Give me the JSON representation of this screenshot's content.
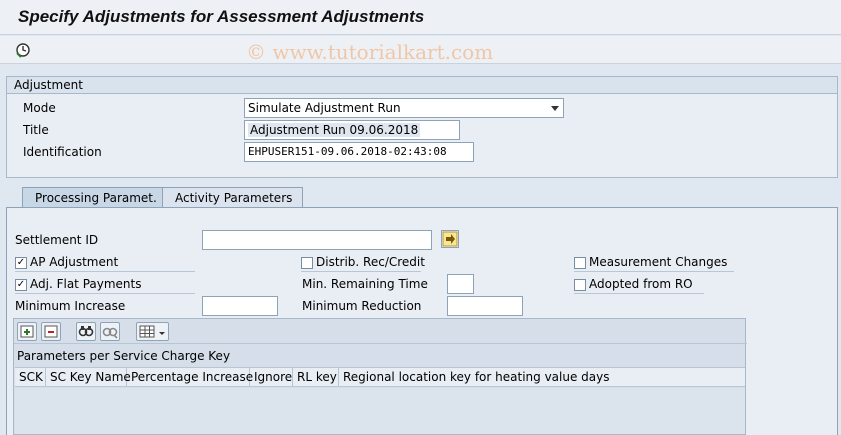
{
  "title": "Specify Adjustments for Assessment Adjustments",
  "watermark": "© www.tutorialkart.com",
  "toolbar": {
    "execute_icon": "execute-clock-icon"
  },
  "adjustment_group": {
    "header": "Adjustment",
    "mode_label": "Mode",
    "mode_value": "Simulate Adjustment Run",
    "title_label": "Title",
    "title_value": "Adjustment Run 09.06.2018",
    "identification_label": "Identification",
    "identification_value": "EHPUSER151-09.06.2018-02:43:08"
  },
  "tabs": [
    {
      "label": "Processing Paramet.",
      "active": true
    },
    {
      "label": "Activity Parameters",
      "active": false
    }
  ],
  "processing": {
    "settlement_id_label": "Settlement ID",
    "settlement_id_value": "",
    "ap_adjustment_label": "AP Adjustment",
    "ap_adjustment_checked": true,
    "distrib_label": "Distrib. Rec/Credit",
    "distrib_checked": false,
    "measurement_label": "Measurement Changes",
    "measurement_checked": false,
    "adj_flat_label": "Adj. Flat Payments",
    "adj_flat_checked": true,
    "min_remaining_label": "Min. Remaining Time",
    "min_remaining_value": "",
    "adopted_label": "Adopted from RO",
    "adopted_checked": false,
    "min_increase_label": "Minimum Increase",
    "min_increase_value": "",
    "min_reduction_label": "Minimum Reduction",
    "min_reduction_value": ""
  },
  "table": {
    "title": "Parameters per Service Charge Key",
    "columns": [
      "SCK",
      "SC Key Name",
      "Percentage Increase",
      "Ignore",
      "RL key",
      "Regional location key for heating value days"
    ]
  },
  "colors": {
    "background": "#dfe8f1",
    "panel": "#e9eef4",
    "border": "#8fa3b8"
  }
}
